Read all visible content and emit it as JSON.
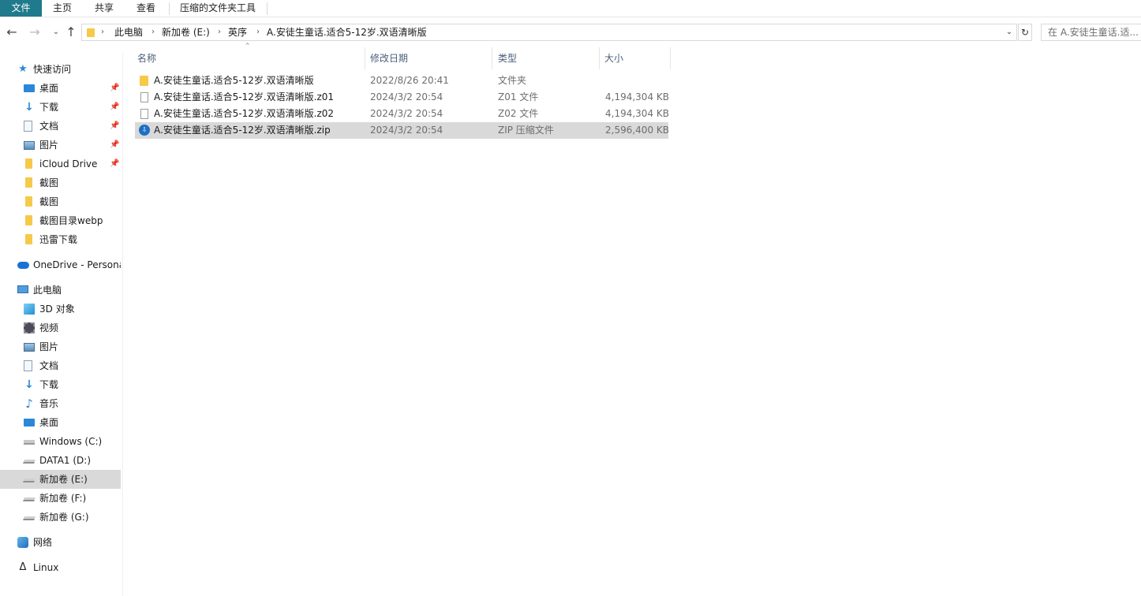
{
  "ribbon": {
    "tabs": [
      "文件",
      "主页",
      "共享",
      "查看",
      "压缩的文件夹工具"
    ]
  },
  "nav": {
    "back_icon": "back-arrow-icon",
    "forward_icon": "forward-arrow-icon",
    "up_icon": "up-arrow-icon"
  },
  "address": {
    "crumbs": [
      "此电脑",
      "新加卷 (E:)",
      "英序",
      "A.安徒生童话.适合5-12岁.双语清晰版"
    ]
  },
  "search": {
    "placeholder": "在 A.安徒生童话.适..."
  },
  "sidebar": {
    "quick_access": {
      "label": "快速访问",
      "items": [
        "桌面",
        "下载",
        "文档",
        "图片",
        "iCloud Drive",
        "截图",
        "截图",
        "截图目录webp",
        "迅雷下载"
      ]
    },
    "onedrive": "OneDrive - Personal",
    "this_pc": {
      "label": "此电脑",
      "items": [
        "3D 对象",
        "视频",
        "图片",
        "文档",
        "下载",
        "音乐",
        "桌面",
        "Windows (C:)",
        "DATA1 (D:)",
        "新加卷 (E:)",
        "新加卷 (F:)",
        "新加卷 (G:)"
      ]
    },
    "network": "网络",
    "linux": "Linux"
  },
  "columns": {
    "name": "名称",
    "date": "修改日期",
    "type": "类型",
    "size": "大小"
  },
  "files": [
    {
      "name": "A.安徒生童话.适合5-12岁.双语清晰版",
      "date": "2022/8/26 20:41",
      "type": "文件夹",
      "size": "",
      "icon": "folder-icon"
    },
    {
      "name": "A.安徒生童话.适合5-12岁.双语清晰版.z01",
      "date": "2024/3/2 20:54",
      "type": "Z01 文件",
      "size": "4,194,304 KB",
      "icon": "file-icon"
    },
    {
      "name": "A.安徒生童话.适合5-12岁.双语清晰版.z02",
      "date": "2024/3/2 20:54",
      "type": "Z02 文件",
      "size": "4,194,304 KB",
      "icon": "file-icon"
    },
    {
      "name": "A.安徒生童话.适合5-12岁.双语清晰版.zip",
      "date": "2024/3/2 20:54",
      "type": "ZIP 压缩文件",
      "size": "2,596,400 KB",
      "icon": "zip-icon"
    }
  ]
}
